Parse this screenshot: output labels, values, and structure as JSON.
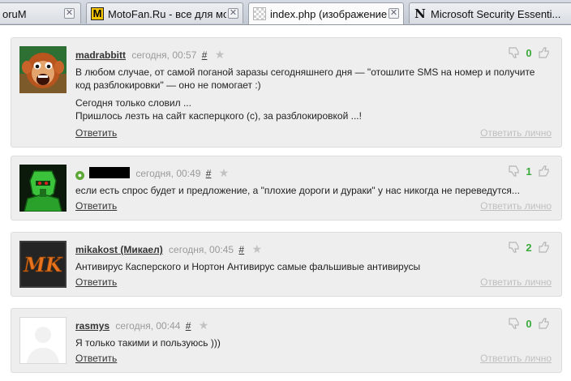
{
  "tabs": [
    {
      "title": "oruM",
      "icon": "forum-favicon",
      "active": false
    },
    {
      "title": "MotoFan.Ru - все для мо...",
      "icon": "motofan-m-icon",
      "active": false
    },
    {
      "title": "index.php (изображение ...",
      "icon": "image-file-icon",
      "active": true
    },
    {
      "title": "Microsoft Security Essenti...",
      "icon": "n-logo-icon",
      "active": false
    }
  ],
  "comments": [
    {
      "author": "madrabbitt",
      "date": "сегодня, 00:57",
      "hash": "#",
      "votes": "0",
      "avatar": "monkey-avatar",
      "text": [
        "В любом случае, от самой поганой заразы сегодняшнего дня — \"отошлите SMS на номер и получите код разблокировки\" — оно не помогает :)",
        "Сегодня только словил ...\nПришлось лезть на сайт касперцкого (с), за разблокировкой ...!"
      ],
      "reply": "Ответить",
      "private": "Ответить лично"
    },
    {
      "author": "",
      "date": "сегодня, 00:49",
      "hash": "#",
      "votes": "1",
      "avatar": "green-robot-avatar",
      "text": [
        "если есть спрос будет и предложение, а \"плохие дороги и дураки\" у нас никогда не переведутся..."
      ],
      "reply": "Ответить",
      "private": "Ответить лично"
    },
    {
      "author": "mikakost (Микаел)",
      "date": "сегодня, 00:45",
      "hash": "#",
      "votes": "2",
      "avatar": "mk-logo-avatar",
      "avatar_text": "MK",
      "text": [
        "Антивирус Касперского и Нортон Антивирус самые фальшивые антивирусы"
      ],
      "reply": "Ответить",
      "private": "Ответить лично"
    },
    {
      "author": "rasmys",
      "date": "сегодня, 00:44",
      "hash": "#",
      "votes": "0",
      "avatar": "default-avatar",
      "text": [
        "Я только такими и пользуюсь )))"
      ],
      "reply": "Ответить",
      "private": "Ответить лично"
    }
  ],
  "colors": {
    "vote_count": "#3aa83a",
    "card_bg": "#eeeeee",
    "muted": "#9a9a9a"
  }
}
